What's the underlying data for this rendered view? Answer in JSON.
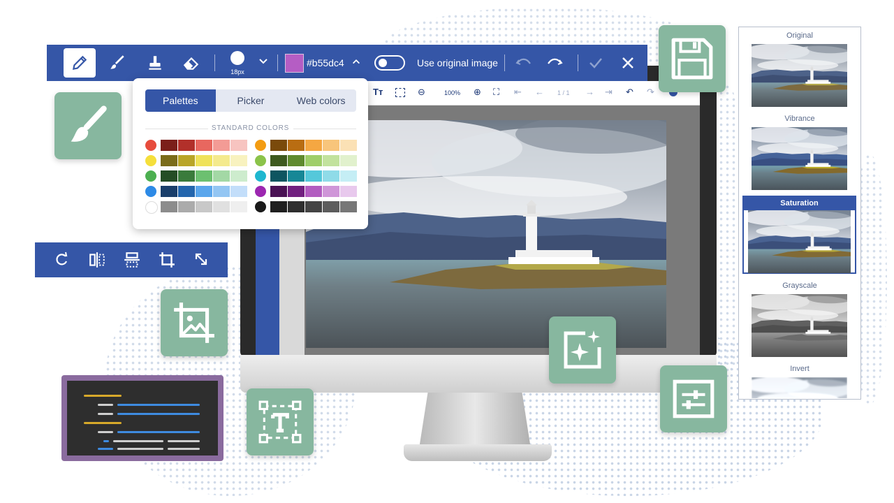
{
  "toolbar": {
    "brush_size": "18px",
    "color_hex": "#b55dc4",
    "color_swatch": "#b55dc4",
    "use_original_label": "Use original image"
  },
  "color_popover": {
    "tabs": [
      {
        "label": "Palettes",
        "active": true
      },
      {
        "label": "Picker",
        "active": false
      },
      {
        "label": "Web colors",
        "active": false
      }
    ],
    "section_title": "STANDARD COLORS",
    "left_rows": [
      {
        "dot": "#e74c3c",
        "cells": [
          "#7b1f1a",
          "#b2302a",
          "#e8675f",
          "#f39b95",
          "#f7c4c0"
        ]
      },
      {
        "dot": "#f5df3b",
        "cells": [
          "#7a6c1a",
          "#b9a528",
          "#efe25a",
          "#f4ea8d",
          "#f8f2bf"
        ]
      },
      {
        "dot": "#4caf50",
        "cells": [
          "#244d25",
          "#3a7b3c",
          "#6cc070",
          "#a3d8a5",
          "#cdeccd"
        ]
      },
      {
        "dot": "#2d8ae6",
        "cells": [
          "#1a3f6b",
          "#2466ad",
          "#5aa6ec",
          "#93c6f3",
          "#c3defa"
        ]
      },
      {
        "dot": "#ffffff",
        "cells": [
          "#8c8c8c",
          "#ababab",
          "#c8c8c8",
          "#e0e0e0",
          "#efefef"
        ]
      }
    ],
    "right_rows": [
      {
        "dot": "#f39c12",
        "cells": [
          "#7a4a0b",
          "#b96d12",
          "#f5a742",
          "#f8c57b",
          "#fbe1b5"
        ]
      },
      {
        "dot": "#8bc34a",
        "cells": [
          "#3e5a1f",
          "#5f8a2e",
          "#9fce6a",
          "#c2e29d",
          "#e1f1cd"
        ]
      },
      {
        "dot": "#1fb7cf",
        "cells": [
          "#0d5560",
          "#168796",
          "#55c8da",
          "#8fdbe8",
          "#c5eef5"
        ]
      },
      {
        "dot": "#9c27b0",
        "cells": [
          "#4a1254",
          "#71207f",
          "#b25dc0",
          "#cf96d8",
          "#e8c9ed"
        ]
      },
      {
        "dot": "#1a1a1a",
        "cells": [
          "#1f1f1f",
          "#2e2e2e",
          "#444444",
          "#5c5c5c",
          "#777777"
        ]
      }
    ]
  },
  "screen": {
    "zoom": "100%",
    "page_indicator": "1 / 1"
  },
  "filters": {
    "items": [
      {
        "label": "Original",
        "style": "none"
      },
      {
        "label": "Vibrance",
        "style": "saturate(1.4)"
      },
      {
        "label": "Saturation",
        "style": "saturate(1.2)",
        "selected": true
      },
      {
        "label": "Grayscale",
        "style": "grayscale(1)"
      },
      {
        "label": "Invert",
        "style": "none"
      }
    ]
  }
}
